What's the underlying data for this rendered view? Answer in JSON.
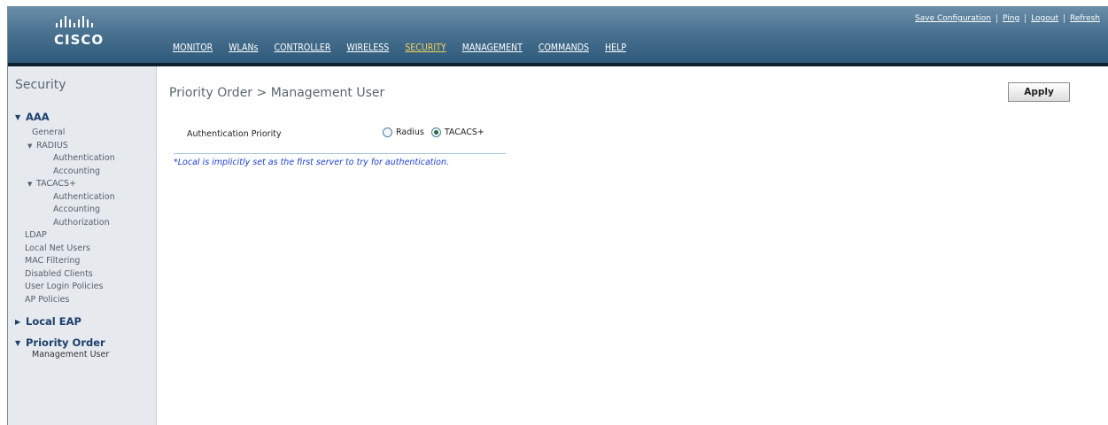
{
  "header": {
    "logo_text": "CISCO",
    "nav": [
      "MONITOR",
      "WLANs",
      "CONTROLLER",
      "WIRELESS",
      "SECURITY",
      "MANAGEMENT",
      "COMMANDS",
      "HELP"
    ],
    "active_nav": "SECURITY",
    "util_links": [
      "Save Configuration",
      "Ping",
      "Logout",
      "Refresh"
    ]
  },
  "sidebar": {
    "title": "Security",
    "aaa": {
      "label": "AAA",
      "general": "General",
      "radius": "RADIUS",
      "radius_auth": "Authentication",
      "radius_acct": "Accounting",
      "tacacs": "TACACS+",
      "tacacs_auth": "Authentication",
      "tacacs_acct": "Accounting",
      "tacacs_authz": "Authorization",
      "ldap": "LDAP",
      "local_net_users": "Local Net Users",
      "mac_filtering": "MAC Filtering",
      "disabled_clients": "Disabled Clients",
      "user_login_policies": "User Login Policies",
      "ap_policies": "AP Policies"
    },
    "local_eap": "Local EAP",
    "priority_order": {
      "label": "Priority Order",
      "management_user": "Management User"
    }
  },
  "main": {
    "title": "Priority Order > Management User",
    "apply_label": "Apply",
    "auth_priority_label": "Authentication Priority",
    "options": [
      "Radius",
      "TACACS+"
    ],
    "selected_option": "TACACS+",
    "note": "*Local is implicitly set as the first server to try for authentication."
  },
  "colors": {
    "header_top": "#6b8ea8",
    "header_bottom": "#2f5a7a",
    "active_nav": "#f5d35b",
    "sidebar_bg": "#e6eaee",
    "note_text": "#1b3fcf"
  }
}
